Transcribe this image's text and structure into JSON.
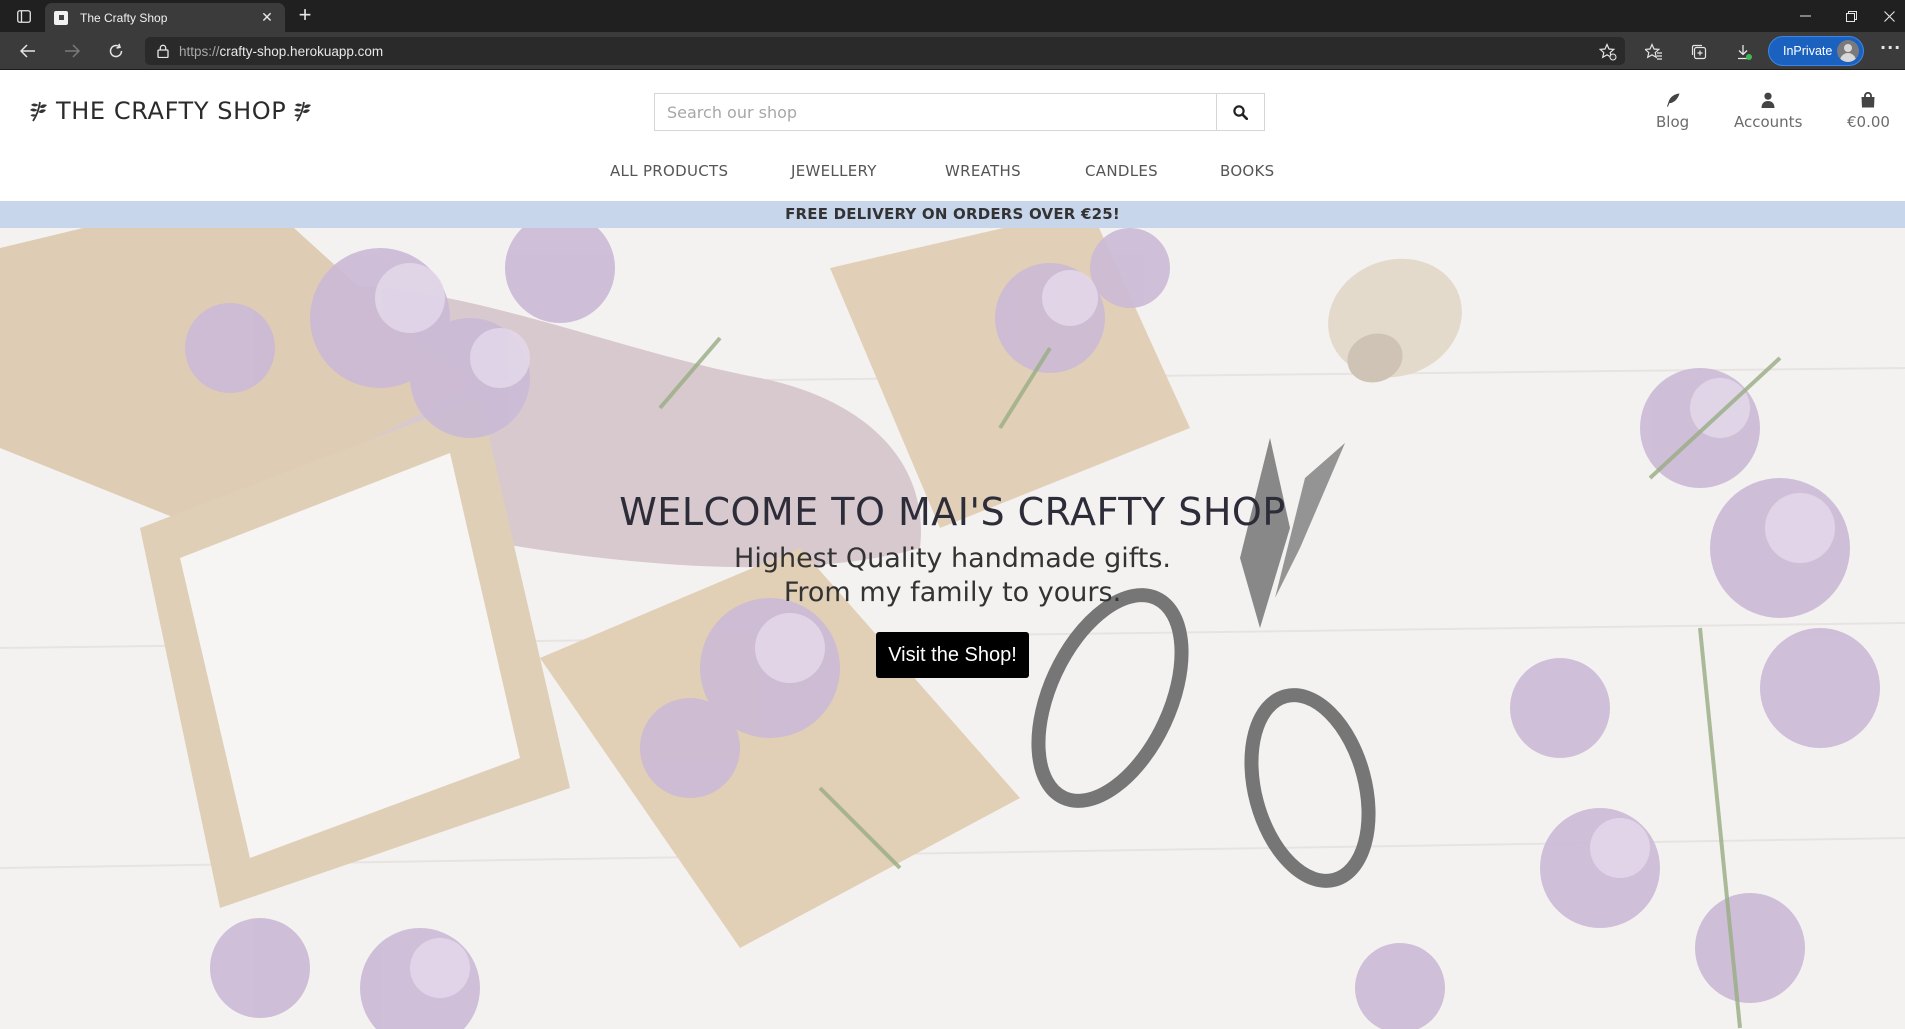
{
  "browser": {
    "tab_title": "The Crafty Shop",
    "url_scheme": "https://",
    "url_host": "crafty-shop.herokuapp.com",
    "inprivate_label": "InPrivate"
  },
  "header": {
    "logo_text": "THE CRAFTY SHOP",
    "search_placeholder": "Search our shop",
    "nav_blog": "Blog",
    "nav_accounts": "Accounts",
    "nav_bag_total": "€0.00"
  },
  "main_nav": {
    "items": [
      "ALL PRODUCTS",
      "JEWELLERY",
      "WREATHS",
      "CANDLES",
      "BOOKS"
    ]
  },
  "promo_banner": "FREE DELIVERY ON ORDERS OVER €25!",
  "hero": {
    "title": "WELCOME TO MAI'S CRAFTY SHOP",
    "subtitle_line1": "Highest Quality handmade gifts.",
    "subtitle_line2": "From my family to yours.",
    "cta_label": "Visit the Shop!"
  },
  "colors": {
    "promo_bg": "#c8d6ec",
    "cta_bg": "#000000",
    "inprivate_bg": "#1b62c0"
  }
}
